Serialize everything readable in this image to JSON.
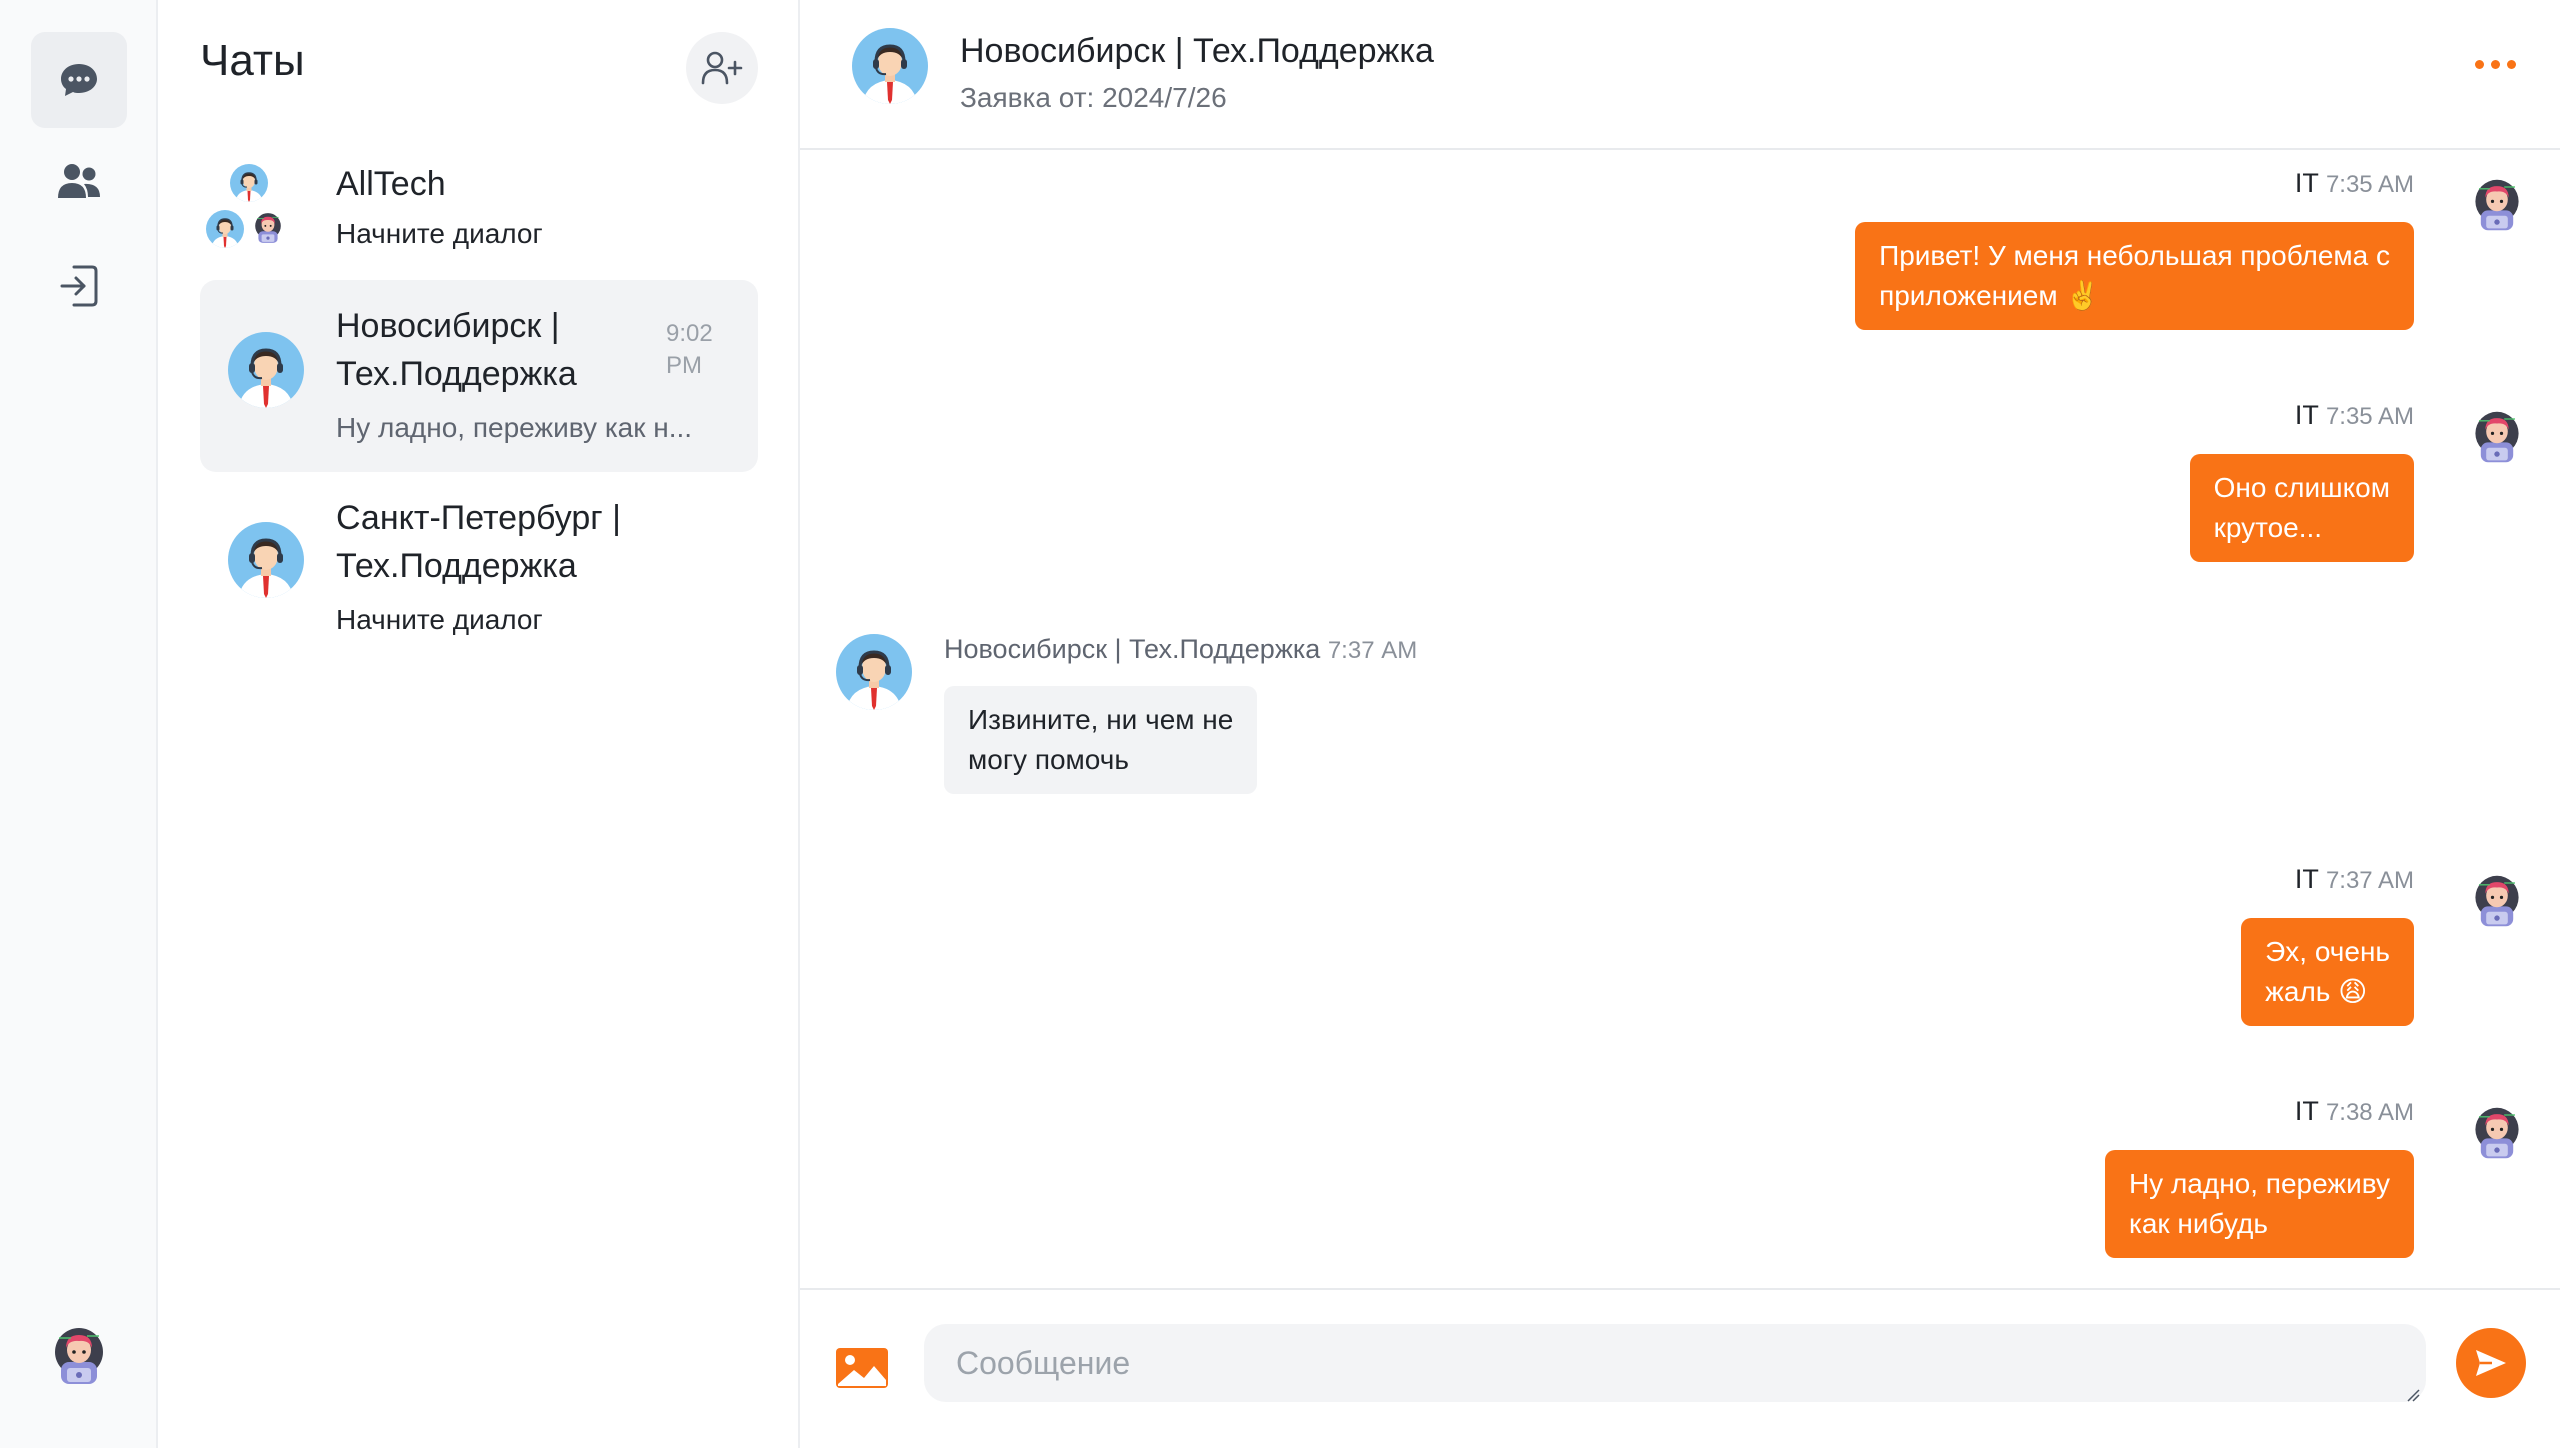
{
  "colors": {
    "accent": "#f97316",
    "bubble_in": "#f2f3f5",
    "rail_bg": "#f9fafb"
  },
  "rail": {
    "items": [
      {
        "icon": "chat-bubble-icon",
        "active": true
      },
      {
        "icon": "users-icon",
        "active": false
      },
      {
        "icon": "logout-icon",
        "active": false
      }
    ],
    "user_avatar": "user-avatar"
  },
  "chatlist": {
    "title": "Чаты",
    "add_icon": "add-user-icon",
    "items": [
      {
        "name": "AllTech",
        "preview": "Начните диалог",
        "time": "",
        "avatar": "group-avatar"
      },
      {
        "name_line1": "Новосибирск |",
        "name_line2": "Тех.Поддержка",
        "preview": "Ну ладно, переживу как н...",
        "time_line1": "9:02",
        "time_line2": "PM",
        "avatar": "support-avatar"
      },
      {
        "name_line1": "Санкт-Петербург |",
        "name_line2": "Тех.Поддержка",
        "preview": "Начните диалог",
        "avatar": "support-avatar"
      }
    ]
  },
  "conversation": {
    "title": "Новосибирск | Тех.Поддержка",
    "subtitle": "Заявка от: 2024/7/26",
    "menu_icon": "more-dots-icon",
    "messages": [
      {
        "sender": "IT",
        "time": "7:35 AM",
        "text_line1": "Привет! У меня небольшая проблема с",
        "text_line2": "приложением ✌️",
        "direction": "out"
      },
      {
        "sender": "IT",
        "time": "7:35 AM",
        "text_line1": "Оно слишком",
        "text_line2": "крутое...",
        "direction": "out"
      },
      {
        "sender": "Новосибирск | Тех.Поддержка",
        "time": "7:37 AM",
        "text_line1": "Извините, ни чем не",
        "text_line2": "могу помочь",
        "direction": "in"
      },
      {
        "sender": "IT",
        "time": "7:37 AM",
        "text_line1": "Эх, очень",
        "text_line2": "жаль 😩",
        "direction": "out"
      },
      {
        "sender": "IT",
        "time": "7:38 AM",
        "text_line1": "Ну ладно, переживу",
        "text_line2": "как нибудь",
        "direction": "out"
      }
    ]
  },
  "composer": {
    "placeholder": "Сообщение",
    "image_icon": "image-icon",
    "send_icon": "send-icon"
  }
}
